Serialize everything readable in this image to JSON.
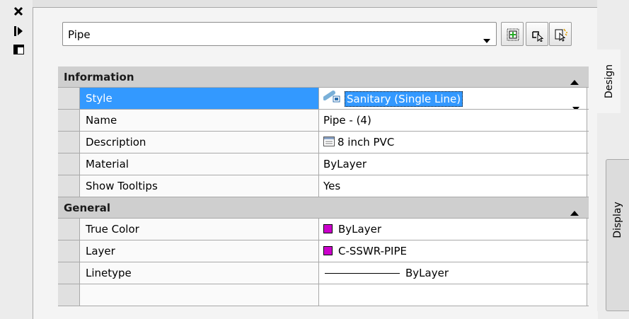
{
  "toolbar": {
    "selected_object": "Pipe"
  },
  "tabs": {
    "design": "Design",
    "display": "Display"
  },
  "categories": {
    "information": {
      "label": "Information",
      "rows": [
        {
          "name": "Style",
          "value": "Sanitary (Single Line)"
        },
        {
          "name": "Name",
          "value": "Pipe - (4)"
        },
        {
          "name": "Description",
          "value": "8 inch PVC"
        },
        {
          "name": "Material",
          "value": "ByLayer"
        },
        {
          "name": "Show Tooltips",
          "value": "Yes"
        }
      ]
    },
    "general": {
      "label": "General",
      "rows": [
        {
          "name": "True Color",
          "value": "ByLayer"
        },
        {
          "name": "Layer",
          "value": "C-SSWR-PIPE"
        },
        {
          "name": "Linetype",
          "value": "ByLayer"
        }
      ]
    }
  },
  "colors": {
    "selection": "#3399ff",
    "layer_swatch": "#cc00cc",
    "category_header": "#cfcfcf"
  },
  "icons": {
    "close": "close-icon",
    "autohide": "autohide-icon",
    "properties": "properties-icon",
    "quick_select": "quick-select-icon",
    "select_objects": "select-objects-icon",
    "pickadd": "pickadd-icon",
    "style": "pipe-style-icon",
    "description": "description-worksheet-icon"
  }
}
